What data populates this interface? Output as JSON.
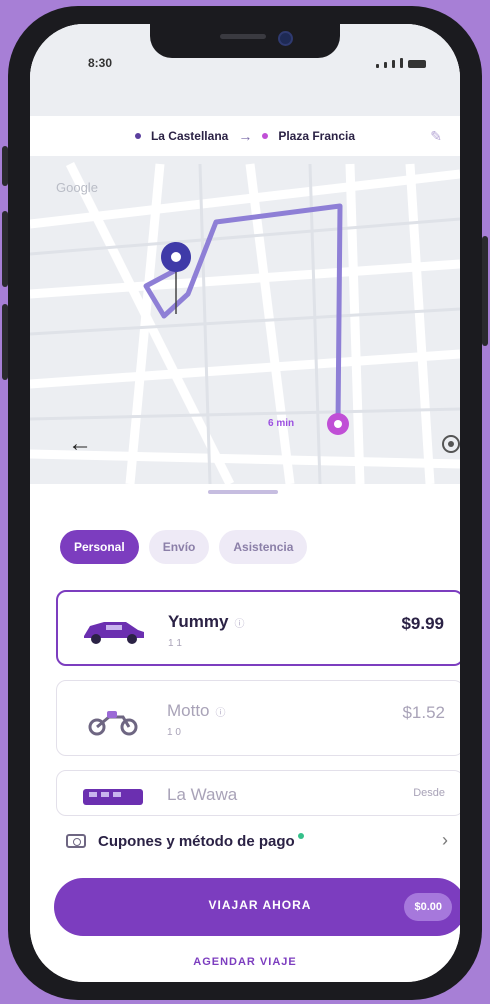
{
  "status_bar": {
    "time": "8:30"
  },
  "route": {
    "origin": "La Castellana",
    "destination": "Plaza Francia",
    "origin_color": "#5b3f9e",
    "destination_color": "#c04fd6"
  },
  "map": {
    "provider": "Google",
    "eta": "6 min"
  },
  "tabs": [
    {
      "label": "Personal",
      "active": true
    },
    {
      "label": "Envío",
      "active": false
    },
    {
      "label": "Asistencia",
      "active": false
    }
  ],
  "options": [
    {
      "name": "Yummy",
      "price": "$9.99",
      "meta": "1  1",
      "selected": true,
      "icon": "car-icon"
    },
    {
      "name": "Motto",
      "price": "$1.52",
      "meta": "1  0",
      "selected": false,
      "icon": "motorcycle-icon"
    },
    {
      "name": "La Wawa",
      "price": "Desde",
      "meta": "",
      "selected": false,
      "icon": "bus-icon"
    }
  ],
  "payment": {
    "label": "Cupones y método de pago"
  },
  "cta": {
    "label": "VIAJAR AHORA",
    "price": "$0.00"
  },
  "schedule": {
    "label": "AGENDAR VIAJE"
  },
  "colors": {
    "accent": "#7c3dbf",
    "background": "#a77fd6"
  }
}
